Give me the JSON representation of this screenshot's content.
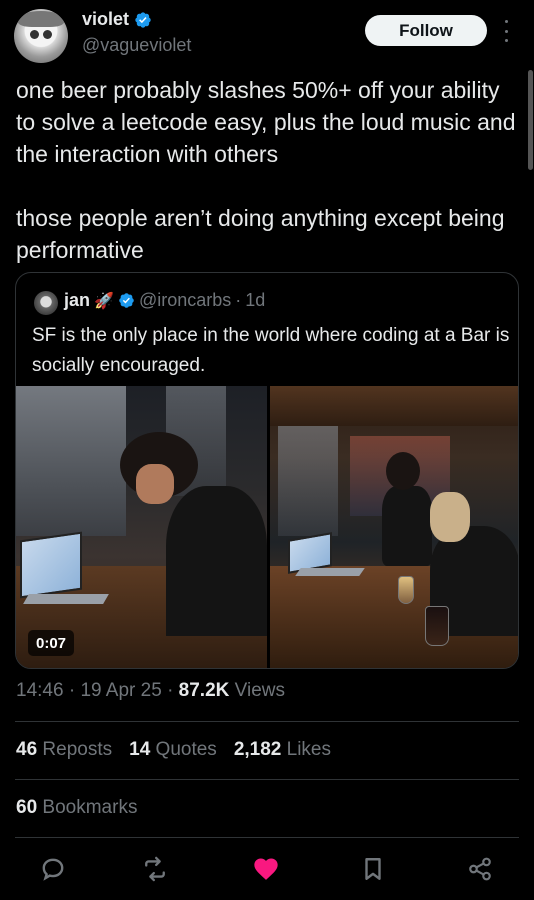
{
  "author": {
    "display_name": "violet",
    "handle": "@vagueviolet",
    "verified": true
  },
  "follow_label": "Follow",
  "tweet": {
    "text": "one beer probably slashes 50%+ off your ability to solve a leetcode easy, plus the loud music and the interaction with others\n\nthose people aren’t doing anything except being performative"
  },
  "quoted": {
    "display_name": "jan",
    "emoji": "🚀",
    "handle": "@ironcarbs",
    "separator": "·",
    "time": "1d",
    "text": "SF is the only place in the world where coding at a Bar is socially encouraged.",
    "video_duration": "0:07"
  },
  "meta": {
    "time": "14:46",
    "date": "19 Apr 25",
    "separator": "·",
    "views_count": "87.2K",
    "views_label": "Views"
  },
  "stats": {
    "reposts_count": "46",
    "reposts_label": "Reposts",
    "quotes_count": "14",
    "quotes_label": "Quotes",
    "likes_count": "2,182",
    "likes_label": "Likes",
    "bookmarks_count": "60",
    "bookmarks_label": "Bookmarks"
  },
  "colors": {
    "background": "#000000",
    "text": "#e7e9ea",
    "secondary": "#71767b",
    "verified_blue": "#1d9bf0",
    "like_pink": "#f91880",
    "follow_bg": "#eff3f4"
  },
  "icons": {
    "reply": "reply-icon",
    "repost": "repost-icon",
    "like": "heart-icon",
    "bookmark": "bookmark-icon",
    "share": "share-icon"
  }
}
